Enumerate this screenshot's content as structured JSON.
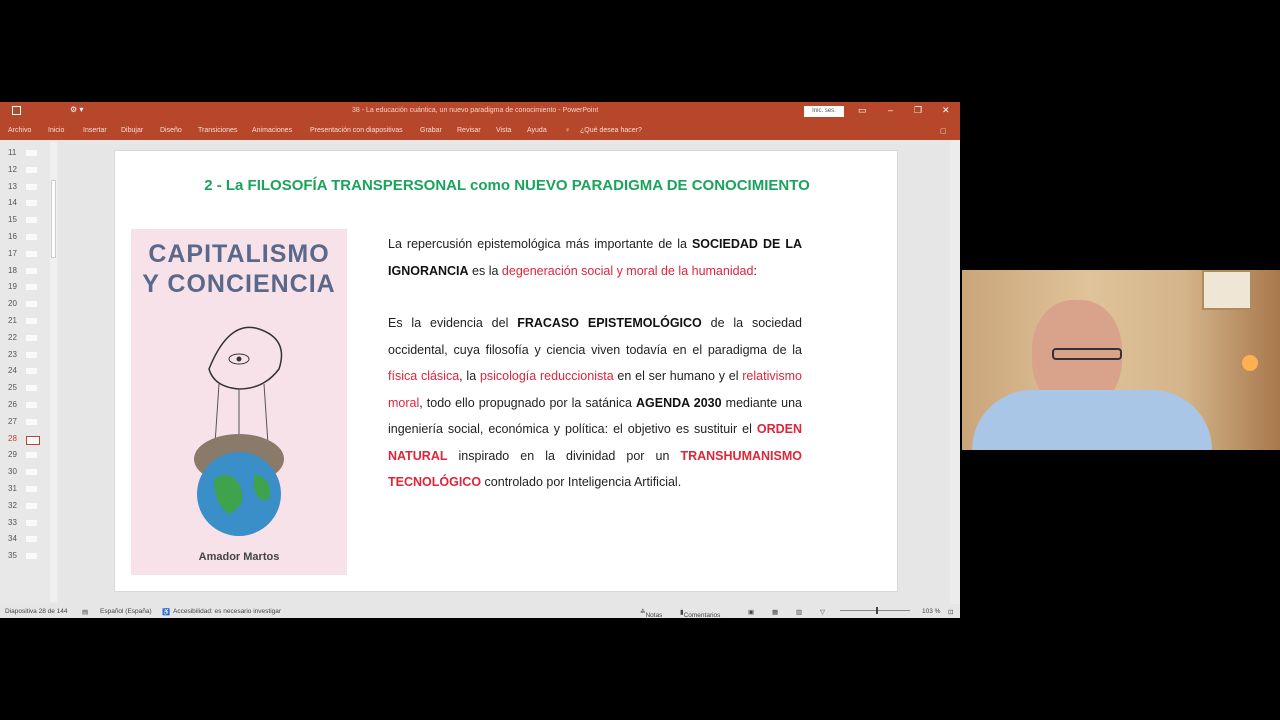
{
  "window": {
    "title": "38 - La educación cuántica, un nuevo paradigma de conocimiento - PowerPoint",
    "signin_label": "Inic. ses."
  },
  "ribbon": {
    "tabs": [
      "Archivo",
      "Inicio",
      "Insertar",
      "Dibujar",
      "Diseño",
      "Transiciones",
      "Animaciones",
      "Presentación con diapositivas",
      "Grabar",
      "Revisar",
      "Vista",
      "Ayuda"
    ],
    "tell_me": "¿Qué desea hacer?"
  },
  "thumbnails": {
    "numbers": [
      "11",
      "12",
      "13",
      "14",
      "15",
      "16",
      "17",
      "18",
      "19",
      "20",
      "21",
      "22",
      "23",
      "24",
      "25",
      "26",
      "27",
      "28",
      "29",
      "30",
      "31",
      "32",
      "33",
      "34",
      "35"
    ],
    "selected": "28"
  },
  "slide": {
    "title": "2 - La FILOSOFÍA TRANSPERSONAL como NUEVO PARADIGMA DE CONOCIMIENTO",
    "book": {
      "title_line1": "CAPITALISMO",
      "title_line2": "Y CONCIENCIA",
      "author": "Amador Martos"
    },
    "p1": {
      "a": "La repercusión epistemológica más importante de la ",
      "b": "SOCIEDAD DE LA IGNORANCIA",
      "c": " es la ",
      "d": "degeneración social y moral de la humanidad",
      "e": ":"
    },
    "p2": {
      "a": " Es la evidencia del ",
      "b": "FRACASO EPISTEMOLÓGICO",
      "c": "  de la sociedad occidental, cuya filosofía y ciencia viven todavía en el paradigma de la ",
      "d": "física clásica",
      "e": ", la ",
      "f": "psicología reduccionista",
      "g": " en el ser humano y el ",
      "h": "relativismo moral",
      "i": ", todo ello propugnado por la satánica ",
      "j": "AGENDA 2030",
      "k": " mediante una ingeniería social, económica y política: el objetivo es sustituir el ",
      "l": "ORDEN NATURAL",
      "m": " inspirado en la divinidad por un ",
      "n": "TRANSHUMANISMO TECNOLÓGICO",
      "o": " controlado por Inteligencia Artificial."
    }
  },
  "status": {
    "slide_count": "Diapositiva 28 de 144",
    "language": "Español (España)",
    "accessibility": "Accesibilidad: es necesario investigar",
    "notes": "Notas",
    "comments": "Comentarios",
    "zoom": "103 %"
  },
  "colors": {
    "accent": "#b7472a",
    "title_green": "#1aa35a",
    "highlight_red": "#e0243a"
  }
}
